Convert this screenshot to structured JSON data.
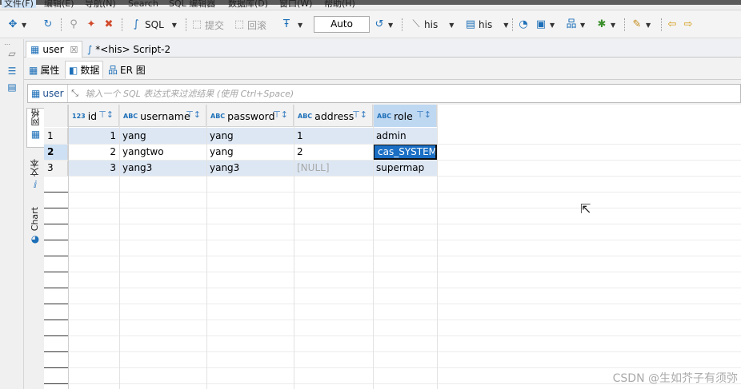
{
  "menubar": {
    "items": [
      "文件(F)",
      "编辑(E)",
      "导航(N)",
      "Search",
      "SQL 编辑器",
      "数据库(D)",
      "窗口(W)",
      "帮助(H)"
    ]
  },
  "toolbar": {
    "sql_label": "SQL",
    "commit_label": "提交",
    "rollback_label": "回滚",
    "transaction_mode": "Auto",
    "his_label_1": "his",
    "his_label_2": "his"
  },
  "editor_tabs": [
    {
      "label": "user",
      "active": true,
      "icon": "table-icon"
    },
    {
      "label": "*<his> Script-2",
      "active": false,
      "icon": "sql-script-icon"
    }
  ],
  "sub_tabs": [
    {
      "label": "属性",
      "icon": "properties-icon"
    },
    {
      "label": "数据",
      "icon": "data-grid-icon",
      "active": true
    },
    {
      "label": "ER 图",
      "icon": "er-diagram-icon"
    }
  ],
  "filter": {
    "table_name": "user",
    "placeholder": "输入一个 SQL 表达式来过滤结果 (使用 Ctrl+Space)"
  },
  "view_tabs": [
    {
      "label": "网格",
      "icon": "grid-icon",
      "active": true
    },
    {
      "label": "文本",
      "icon": "text-icon"
    },
    {
      "label": "Chart",
      "icon": "pie-chart-icon"
    }
  ],
  "table": {
    "columns": [
      {
        "name": "id",
        "type": "123"
      },
      {
        "name": "username",
        "type": "ABC"
      },
      {
        "name": "password",
        "type": "ABC"
      },
      {
        "name": "address",
        "type": "ABC"
      },
      {
        "name": "role",
        "type": "ABC"
      }
    ],
    "rows": [
      {
        "rownum": "1",
        "cells": [
          "1",
          "yang",
          "yang",
          "1",
          "admin"
        ]
      },
      {
        "rownum": "2",
        "cells": [
          "2",
          "yangtwo",
          "yang",
          "2",
          "cas_SYSTEM"
        ]
      },
      {
        "rownum": "3",
        "cells": [
          "3",
          "yang3",
          "yang3",
          "[NULL]",
          "supermap"
        ]
      }
    ]
  },
  "watermark": "CSDN @生如芥子有须弥"
}
